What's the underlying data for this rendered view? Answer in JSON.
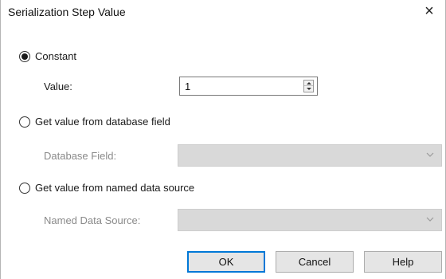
{
  "dialog": {
    "title": "Serialization Step Value",
    "close_glyph": "×"
  },
  "options": {
    "constant": {
      "label": "Constant",
      "selected": true,
      "value_label": "Value:",
      "value": "1"
    },
    "database": {
      "label": "Get value from database field",
      "selected": false,
      "field_label": "Database Field:"
    },
    "named_source": {
      "label": "Get value from named data source",
      "selected": false,
      "field_label": "Named Data Source:"
    }
  },
  "buttons": {
    "ok": "OK",
    "cancel": "Cancel",
    "help": "Help"
  },
  "icons": {
    "close": "close-icon",
    "spin_up": "chevron-up-icon",
    "spin_down": "chevron-down-icon",
    "combo": "chevron-down-icon"
  },
  "colors": {
    "accent": "#0078d7",
    "disabled_field": "#d9d9d9",
    "disabled_text": "#8a8a8a"
  }
}
